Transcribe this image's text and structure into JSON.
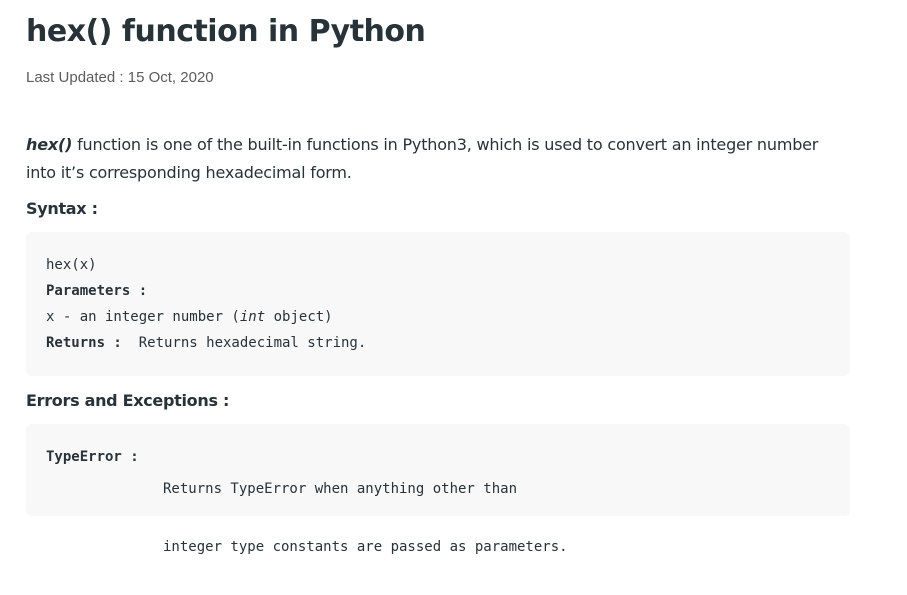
{
  "article": {
    "title": "hex() function in Python",
    "last_updated": "Last Updated : 15 Oct, 2020",
    "intro": {
      "function_name": "hex()",
      "text": " function is one of the built-in functions in Python3, which is used to convert an integer number into it’s corresponding hexadecimal form."
    },
    "syntax": {
      "heading": "Syntax :",
      "signature": "hex(x)",
      "parameters_label": "Parameters :",
      "param_prefix": "x - an integer number (",
      "param_type": "int",
      "param_suffix": " object)",
      "returns_label": "Returns :",
      "returns_text": "  Returns hexadecimal string."
    },
    "errors": {
      "heading": "Errors and Exceptions :",
      "label": "TypeError :",
      "line1": "Returns TypeError when anything other than",
      "line2": "integer type constants are passed as parameters."
    }
  }
}
